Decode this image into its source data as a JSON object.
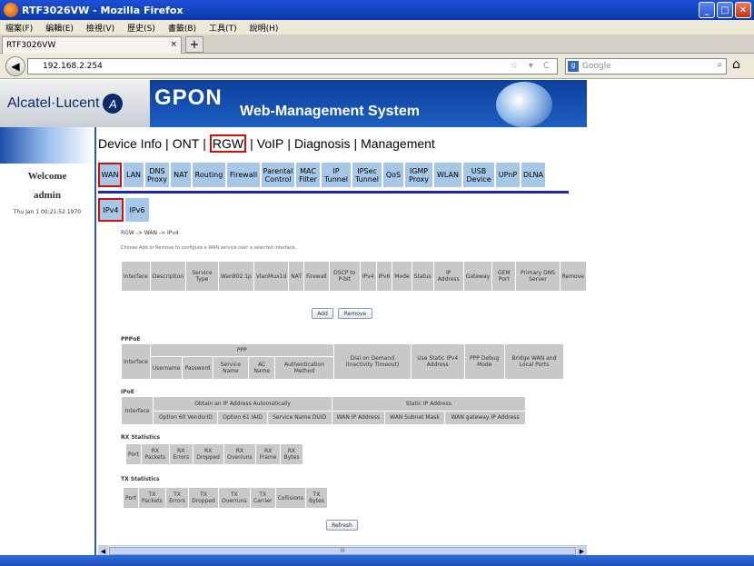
{
  "window": {
    "title": "RTF3026VW - Mozilla Firefox",
    "buttons": [
      "_",
      "□",
      "✕"
    ]
  },
  "menu": [
    "檔案(F)",
    "編輯(E)",
    "檢視(V)",
    "歷史(S)",
    "書籤(B)",
    "工具(T)",
    "說明(H)"
  ],
  "browser_tab": {
    "title": "RTF3026VW",
    "close": "×",
    "new_tab": "+"
  },
  "nav": {
    "url": "192.168.2.254",
    "search_placeholder": "Google",
    "url_icons": "☆ ▾ C"
  },
  "header": {
    "brand": "Alcatel·Lucent",
    "product": "GPON",
    "subtitle": "Web-Management System"
  },
  "user": {
    "welcome": "Welcome",
    "name": "admin",
    "time": "Thu Jan 1 00:21:52 1970"
  },
  "topnav": [
    "Device Info",
    "ONT",
    "RGW",
    "VoIP",
    "Diagnosis",
    "Management"
  ],
  "topnav_active": "RGW",
  "tabs": [
    "WAN",
    "LAN",
    "DNS Proxy",
    "NAT",
    "Routing",
    "Firewall",
    "Parental Control",
    "MAC Filter",
    "IP Tunnel",
    "IPSec Tunnel",
    "QoS",
    "IGMP Proxy",
    "WLAN",
    "USB Device",
    "UPnP",
    "DLNA"
  ],
  "subtabs": [
    "IPv4",
    "IPv6"
  ],
  "breadcrumb": "RGW -> WAN -> IPv4",
  "hint": "Choose Add or Remove to configure a WAN service over a selected interface.",
  "wan_table": [
    "Interface",
    "Description",
    "Service Type",
    "Wan802.1p",
    "VlanMux1d",
    "NAT",
    "Firewall",
    "DSCP to P-bit",
    "IPv4",
    "IPv6",
    "Mode",
    "Status",
    "IP Address",
    "Gateway",
    "GEM Port",
    "Primary DNS Server",
    "Remove"
  ],
  "buttons": {
    "add": "Add",
    "remove": "Remove",
    "refresh": "Refresh"
  },
  "pppoe": {
    "label": "PPPoE",
    "interface": "Interface",
    "ppp": "PPP",
    "cols": [
      "Username",
      "Password",
      "Service Name",
      "AC Name",
      "Authentication Method"
    ],
    "dod": "Dial on Demand (Inactivity Timeout)",
    "static": "Use Static IPv4 Address",
    "debug": "PPP Debug Mode",
    "bridge": "Bridge WAN and Local Ports"
  },
  "ipoe": {
    "label": "IPoE",
    "interface": "Interface",
    "auto": "Obtain an IP Address Automatically",
    "static": "Static IP Address",
    "cols": [
      "Option 60 VendorID",
      "Option 61 IAID",
      "Service Name DUID",
      "WAN IP Address",
      "WAN Subnet Mask",
      "WAN gateway IP Address"
    ]
  },
  "rx": {
    "label": "RX Statistics",
    "cols": [
      "Port",
      "RX Packets",
      "RX Errors",
      "RX Dropped",
      "RX Overruns",
      "RX Frame",
      "RX Bytes"
    ]
  },
  "tx": {
    "label": "TX Statistics",
    "cols": [
      "Port",
      "TX Packets",
      "TX Errors",
      "TX Dropped",
      "TX Overruns",
      "TX Carrier",
      "Collisions",
      "TX Bytes"
    ]
  },
  "scrollbar": {
    "left": "◀",
    "right": "▶",
    "grip": "III"
  }
}
